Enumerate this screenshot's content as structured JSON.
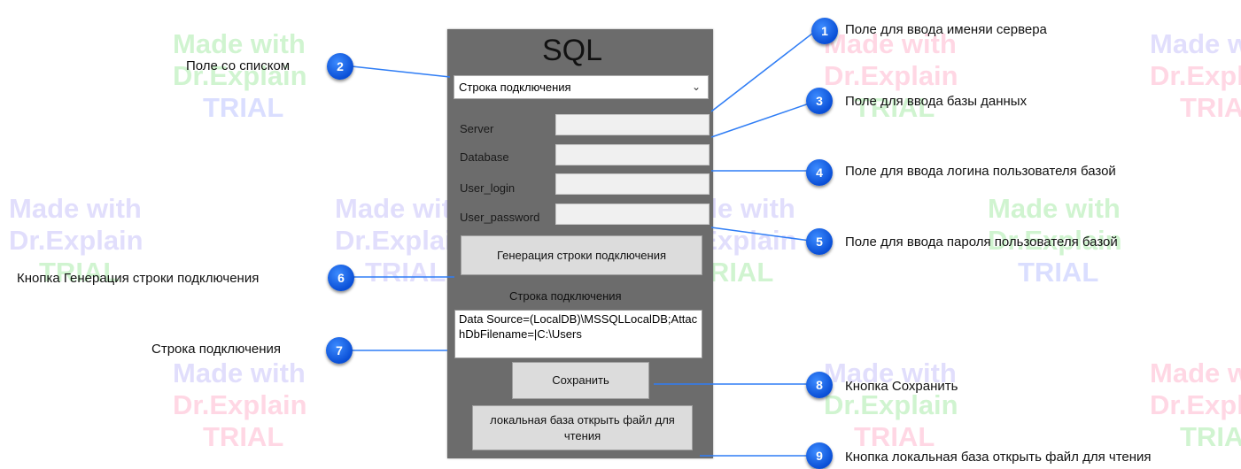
{
  "watermark": {
    "line1": "Made with",
    "line2": "Dr.Explain",
    "line3": "TRIAL"
  },
  "app": {
    "title": "SQL",
    "combo_value": "Строка подключения",
    "fields": {
      "server": "Server",
      "database": "Database",
      "user_login": "User_login",
      "user_password": "User_password"
    },
    "generate_button": "Генерация строки подключения",
    "connection_label": "Строка подключения",
    "connection_text": "Data Source=(LocalDB)\\MSSQLLocalDB;AttachDbFilename=|C:\\Users",
    "save_button": "Сохранить",
    "open_button": "локальная база открыть файл для чтения"
  },
  "callouts": [
    {
      "num": "1",
      "text": "Поле для ввода именяи сервера"
    },
    {
      "num": "2",
      "text": "Поле со списком"
    },
    {
      "num": "3",
      "text": "Поле для ввода базы данных"
    },
    {
      "num": "4",
      "text": "Поле для ввода логина пользователя базой"
    },
    {
      "num": "5",
      "text": "Поле для ввода пароля пользователя базой"
    },
    {
      "num": "6",
      "text": "Кнопка Генерация строки подключения"
    },
    {
      "num": "7",
      "text": "Строка подключения"
    },
    {
      "num": "8",
      "text": "Кнопка Сохранить"
    },
    {
      "num": "9",
      "text": "Кнопка локальная база открыть файл для чтения"
    }
  ]
}
